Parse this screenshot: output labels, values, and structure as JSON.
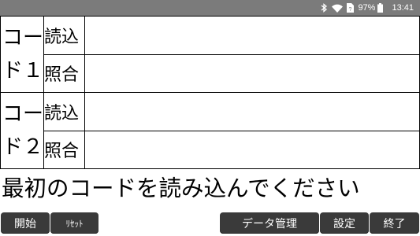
{
  "status_bar": {
    "battery_percent": "97%",
    "time": "13:41",
    "icons": [
      "bluetooth-icon",
      "wifi-icon",
      "sim-icon",
      "battery-icon"
    ]
  },
  "codes": [
    {
      "label_line1": "コー",
      "label_line2": "ド１",
      "rows": [
        {
          "label": "読込",
          "value": ""
        },
        {
          "label": "照合",
          "value": ""
        }
      ]
    },
    {
      "label_line1": "コー",
      "label_line2": "ド２",
      "rows": [
        {
          "label": "読込",
          "value": ""
        },
        {
          "label": "照合",
          "value": ""
        }
      ]
    }
  ],
  "message": "最初のコードを読み込んでください",
  "buttons": {
    "start": "開始",
    "reset": "ﾘｾｯﾄ",
    "data_management": "データ管理",
    "settings": "設定",
    "exit": "終了"
  },
  "colors": {
    "status_bar_bg": "#7b7b7b",
    "button_bg": "#3a3a3a",
    "button_text": "#ffffff",
    "background": "#ffffff"
  }
}
